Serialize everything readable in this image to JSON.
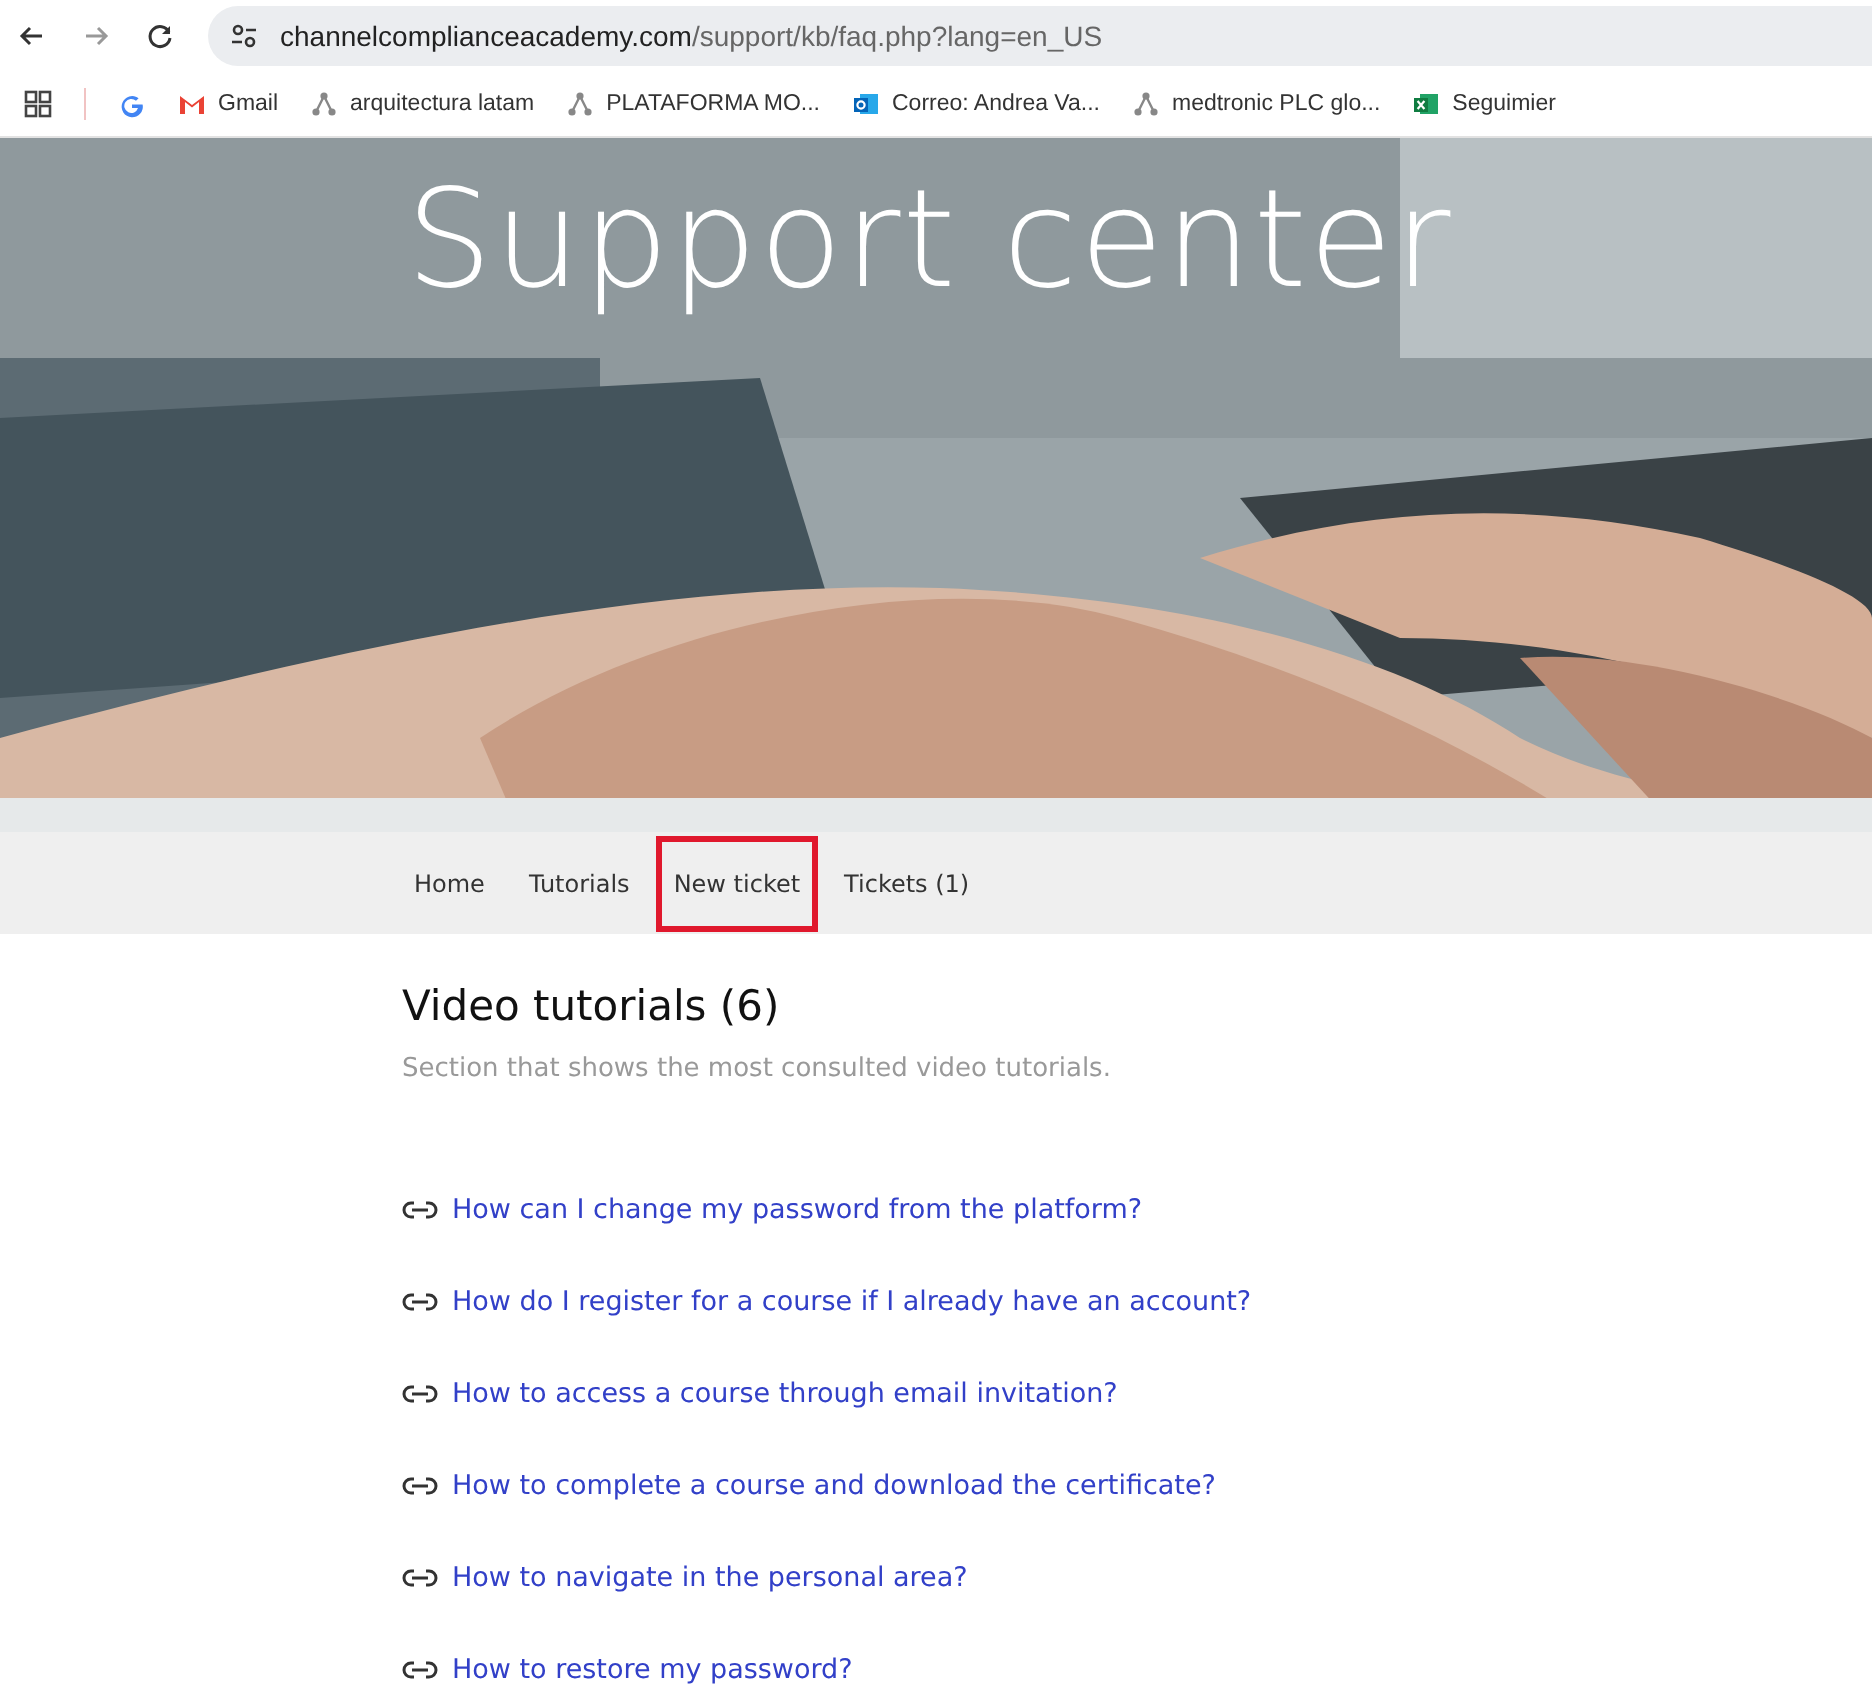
{
  "browser": {
    "url_host": "channelcomplianceacademy.com",
    "url_path": "/support/kb/faq.php?lang=en_US"
  },
  "bookmarks": [
    {
      "kind": "google"
    },
    {
      "kind": "gmail",
      "label": "Gmail"
    },
    {
      "kind": "shared",
      "label": "arquitectura latam"
    },
    {
      "kind": "shared",
      "label": "PLATAFORMA MO..."
    },
    {
      "kind": "outlook",
      "label": "Correo: Andrea Va..."
    },
    {
      "kind": "shared",
      "label": "medtronic PLC glo..."
    },
    {
      "kind": "excel",
      "label": "Seguimier"
    }
  ],
  "hero": {
    "title": "Support center"
  },
  "nav": [
    {
      "label": "Home",
      "highlighted": false
    },
    {
      "label": "Tutorials",
      "highlighted": false
    },
    {
      "label": "New ticket",
      "highlighted": true
    },
    {
      "label": "Tickets (1)",
      "highlighted": false
    }
  ],
  "section": {
    "title": "Video tutorials (6)",
    "description": "Section that shows the most consulted video tutorials."
  },
  "links": [
    "How can I change my password from the platform?",
    "How do I register for a course if I already have an account?",
    "How to access a course through email invitation?",
    "How to complete a course and download the certificate?",
    "How to navigate in the personal area?",
    "How to restore my password?"
  ]
}
